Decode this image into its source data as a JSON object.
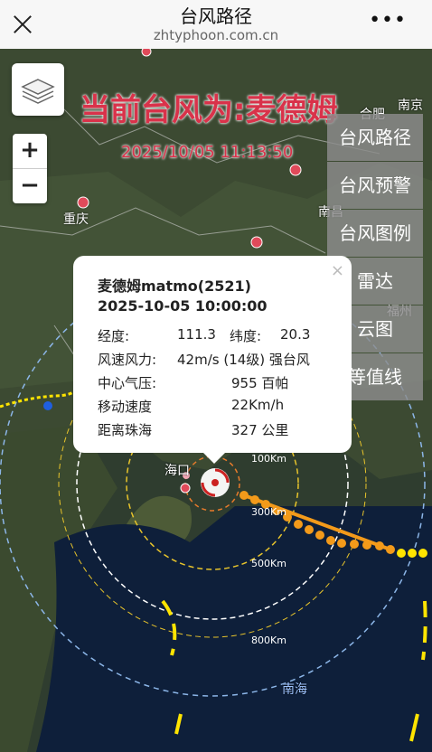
{
  "header": {
    "title": "台风路径",
    "url": "zhtyphoon.com.cn",
    "close_icon": "close-icon",
    "more_icon": "more-icon"
  },
  "map": {
    "current_typhoon_label": "当前台风为:麦德姆",
    "current_time": "2025/10/05 11:13:50",
    "zoom_in": "+",
    "zoom_out": "−",
    "rings": [
      "100Km",
      "300Km",
      "500Km",
      "800Km"
    ],
    "places": [
      "重庆",
      "海口",
      "南海",
      "南昌",
      "福州",
      "南京",
      "合肥"
    ],
    "colors": {
      "accent": "#d9324a",
      "track_orange": "#f39a1a",
      "track_yellow": "#ffe400"
    }
  },
  "menu": [
    "台风路径",
    "台风预警",
    "台风图例",
    "雷达",
    "云图",
    "等值线"
  ],
  "popup": {
    "name": "麦德姆matmo(2521)",
    "time": "2025-10-05 10:00:00",
    "close": "×",
    "rows": [
      {
        "label": "经度:",
        "value": "111.3",
        "label2": "纬度:",
        "value2": "20.3"
      },
      {
        "label": "风速风力:",
        "value": "42m/s (14级) 强台风"
      },
      {
        "label": "中心气压:",
        "value": "955 百帕"
      },
      {
        "label": "移动速度",
        "value": "22Km/h"
      },
      {
        "label": "距离珠海",
        "value": "327 公里"
      }
    ]
  }
}
